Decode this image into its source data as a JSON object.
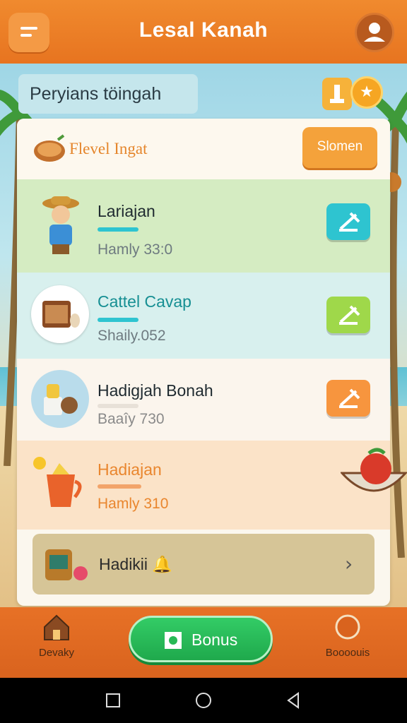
{
  "header": {
    "title": "Lesal Kanah",
    "menu_icon": "menu-icon",
    "profile_icon": "user-icon"
  },
  "subtitle": "Peryians töingah",
  "card": {
    "header_title": "Flevel Ingat",
    "cta_label": "Slomen",
    "rows": [
      {
        "name": "Lariajan",
        "sub": "Hamly 33:0",
        "icon": "farmer-icon",
        "action_icon": "hammer-icon",
        "accent": "#2ec4d0"
      },
      {
        "name": "Cattel Cavap",
        "sub": "Shaily.052",
        "icon": "crate-icon",
        "action_icon": "hammer-icon",
        "accent": "#9fd84a"
      },
      {
        "name": "Hadigjah Bonah",
        "sub": "Baaîy 730",
        "icon": "goods-icon",
        "action_icon": "hammer-icon",
        "accent": "#f7953e"
      },
      {
        "name": "Hadiajan",
        "sub": "Hamly 310",
        "icon": "cup-icon",
        "action_icon": "",
        "accent": "#e9862e"
      }
    ],
    "footer_row": {
      "label": "Hadikii",
      "icon": "machine-icon",
      "chevron": "›"
    }
  },
  "bottom_nav": {
    "left_label": "Devaky",
    "center_label": "Bonus",
    "right_label": "Boooouis"
  },
  "colors": {
    "header": "#e77420",
    "bonus_green": "#28b955",
    "card_bg": "#fbf7ee"
  }
}
